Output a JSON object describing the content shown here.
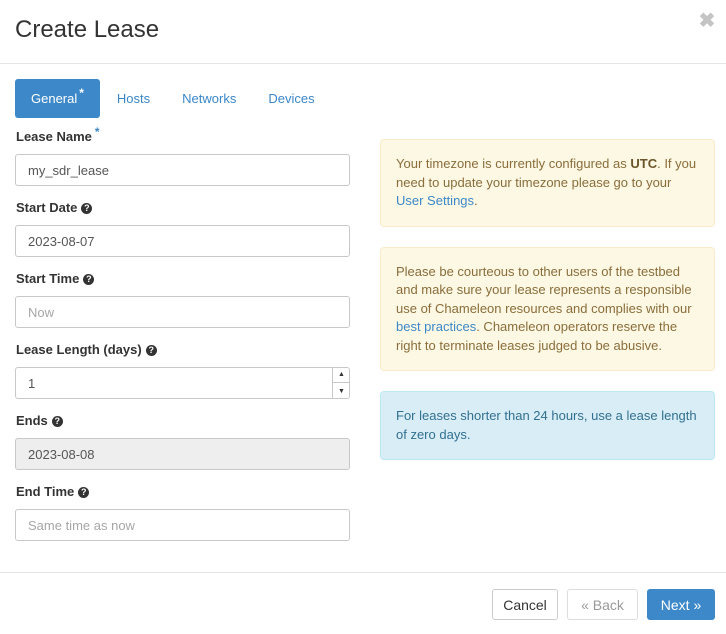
{
  "header": {
    "title": "Create Lease",
    "close_icon": "close-icon"
  },
  "tabs": [
    {
      "label": "General",
      "required_marker": "*",
      "active": true
    },
    {
      "label": "Hosts"
    },
    {
      "label": "Networks"
    },
    {
      "label": "Devices"
    }
  ],
  "form": {
    "lease_name": {
      "label": "Lease Name",
      "required_marker": "*",
      "value": "my_sdr_lease"
    },
    "start_date": {
      "label": "Start Date",
      "value": "2023-08-07",
      "help_icon": "?"
    },
    "start_time": {
      "label": "Start Time",
      "placeholder": "Now",
      "help_icon": "?"
    },
    "lease_length": {
      "label": "Lease Length (days)",
      "value": "1",
      "help_icon": "?",
      "up": "▲",
      "down": "▼"
    },
    "ends": {
      "label": "Ends",
      "value": "2023-08-08",
      "help_icon": "?"
    },
    "end_time": {
      "label": "End Time",
      "placeholder": "Same time as now",
      "help_icon": "?"
    }
  },
  "alerts": {
    "timezone": {
      "text_before": "Your timezone is currently configured as ",
      "tz": "UTC",
      "text_after": ". If you need to update your timezone please go to your ",
      "link": "User Settings",
      "end": "."
    },
    "courtesy": {
      "text_before": "Please be courteous to other users of the testbed and make sure your lease represents a responsible use of Chameleon resources and complies with our ",
      "link": "best practices",
      "text_after": ". Chameleon operators reserve the right to terminate leases judged to be abusive."
    },
    "info": {
      "text": "For leases shorter than 24 hours, use a lease length of zero days."
    }
  },
  "footer": {
    "cancel": "Cancel",
    "back": "«  Back",
    "next": "Next  »"
  }
}
